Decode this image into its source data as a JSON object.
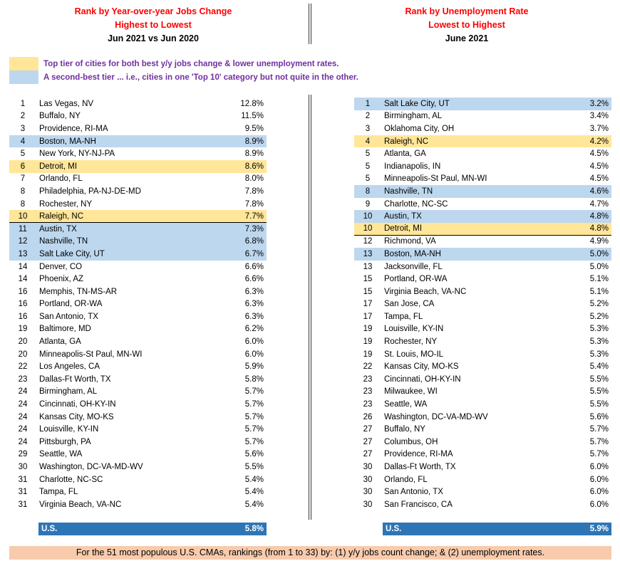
{
  "colors": {
    "title_red": "#ff0000",
    "legend_text": "#7030a0",
    "top_tier": "#ffe699",
    "second_tier": "#bdd7ee",
    "us_bar": "#2e75b6",
    "footer_bg": "#f8cbad"
  },
  "left": {
    "title1": "Rank by Year-over-year Jobs Change",
    "title2": "Highest to Lowest",
    "subtitle": "Jun 2021 vs Jun 2020",
    "rows": [
      {
        "rank": "1",
        "city": "Las Vegas, NV",
        "value": "12.8%",
        "tier": ""
      },
      {
        "rank": "2",
        "city": "Buffalo, NY",
        "value": "11.5%",
        "tier": ""
      },
      {
        "rank": "3",
        "city": "Providence, RI-MA",
        "value": "9.5%",
        "tier": ""
      },
      {
        "rank": "4",
        "city": "Boston, MA-NH",
        "value": "8.9%",
        "tier": "second"
      },
      {
        "rank": "5",
        "city": "New York, NY-NJ-PA",
        "value": "8.9%",
        "tier": ""
      },
      {
        "rank": "6",
        "city": "Detroit, MI",
        "value": "8.6%",
        "tier": "top"
      },
      {
        "rank": "7",
        "city": "Orlando, FL",
        "value": "8.0%",
        "tier": ""
      },
      {
        "rank": "8",
        "city": "Philadelphia, PA-NJ-DE-MD",
        "value": "7.8%",
        "tier": ""
      },
      {
        "rank": "8",
        "city": "Rochester, NY",
        "value": "7.8%",
        "tier": ""
      },
      {
        "rank": "10",
        "city": "Raleigh, NC",
        "value": "7.7%",
        "tier": "top",
        "separator": true
      },
      {
        "rank": "11",
        "city": "Austin, TX",
        "value": "7.3%",
        "tier": "second"
      },
      {
        "rank": "12",
        "city": "Nashville, TN",
        "value": "6.8%",
        "tier": "second"
      },
      {
        "rank": "13",
        "city": "Salt Lake City, UT",
        "value": "6.7%",
        "tier": "second"
      },
      {
        "rank": "14",
        "city": "Denver, CO",
        "value": "6.6%",
        "tier": ""
      },
      {
        "rank": "14",
        "city": "Phoenix, AZ",
        "value": "6.6%",
        "tier": ""
      },
      {
        "rank": "16",
        "city": "Memphis, TN-MS-AR",
        "value": "6.3%",
        "tier": ""
      },
      {
        "rank": "16",
        "city": "Portland, OR-WA",
        "value": "6.3%",
        "tier": ""
      },
      {
        "rank": "16",
        "city": "San Antonio, TX",
        "value": "6.3%",
        "tier": ""
      },
      {
        "rank": "19",
        "city": "Baltimore, MD",
        "value": "6.2%",
        "tier": ""
      },
      {
        "rank": "20",
        "city": "Atlanta, GA",
        "value": "6.0%",
        "tier": ""
      },
      {
        "rank": "20",
        "city": "Minneapolis-St Paul, MN-WI",
        "value": "6.0%",
        "tier": ""
      },
      {
        "rank": "22",
        "city": "Los Angeles, CA",
        "value": "5.9%",
        "tier": ""
      },
      {
        "rank": "23",
        "city": "Dallas-Ft Worth, TX",
        "value": "5.8%",
        "tier": ""
      },
      {
        "rank": "24",
        "city": "Birmingham, AL",
        "value": "5.7%",
        "tier": ""
      },
      {
        "rank": "24",
        "city": "Cincinnati, OH-KY-IN",
        "value": "5.7%",
        "tier": ""
      },
      {
        "rank": "24",
        "city": "Kansas City, MO-KS",
        "value": "5.7%",
        "tier": ""
      },
      {
        "rank": "24",
        "city": "Louisville, KY-IN",
        "value": "5.7%",
        "tier": ""
      },
      {
        "rank": "24",
        "city": "Pittsburgh, PA",
        "value": "5.7%",
        "tier": ""
      },
      {
        "rank": "29",
        "city": "Seattle, WA",
        "value": "5.6%",
        "tier": ""
      },
      {
        "rank": "30",
        "city": "Washington, DC-VA-MD-WV",
        "value": "5.5%",
        "tier": ""
      },
      {
        "rank": "31",
        "city": "Charlotte, NC-SC",
        "value": "5.4%",
        "tier": ""
      },
      {
        "rank": "31",
        "city": "Tampa, FL",
        "value": "5.4%",
        "tier": ""
      },
      {
        "rank": "31",
        "city": "Virginia Beach, VA-NC",
        "value": "5.4%",
        "tier": ""
      }
    ],
    "us": {
      "label": "U.S.",
      "value": "5.8%"
    }
  },
  "right": {
    "title1": "Rank by Unemployment Rate",
    "title2": "Lowest to Highest",
    "subtitle": "June 2021",
    "rows": [
      {
        "rank": "1",
        "city": "Salt Lake City, UT",
        "value": "3.2%",
        "tier": "second"
      },
      {
        "rank": "2",
        "city": "Birmingham, AL",
        "value": "3.4%",
        "tier": ""
      },
      {
        "rank": "3",
        "city": "Oklahoma City, OH",
        "value": "3.7%",
        "tier": ""
      },
      {
        "rank": "4",
        "city": "Raleigh, NC",
        "value": "4.2%",
        "tier": "top"
      },
      {
        "rank": "5",
        "city": "Atlanta, GA",
        "value": "4.5%",
        "tier": ""
      },
      {
        "rank": "5",
        "city": "Indianapolis, IN",
        "value": "4.5%",
        "tier": ""
      },
      {
        "rank": "5",
        "city": "Minneapolis-St Paul, MN-WI",
        "value": "4.5%",
        "tier": ""
      },
      {
        "rank": "8",
        "city": "Nashville, TN",
        "value": "4.6%",
        "tier": "second"
      },
      {
        "rank": "9",
        "city": "Charlotte, NC-SC",
        "value": "4.7%",
        "tier": ""
      },
      {
        "rank": "10",
        "city": "Austin, TX",
        "value": "4.8%",
        "tier": "second"
      },
      {
        "rank": "10",
        "city": "Detroit, MI",
        "value": "4.8%",
        "tier": "top",
        "separator": true
      },
      {
        "rank": "12",
        "city": "Richmond, VA",
        "value": "4.9%",
        "tier": ""
      },
      {
        "rank": "13",
        "city": "Boston, MA-NH",
        "value": "5.0%",
        "tier": "second"
      },
      {
        "rank": "13",
        "city": "Jacksonville, FL",
        "value": "5.0%",
        "tier": ""
      },
      {
        "rank": "15",
        "city": "Portland, OR-WA",
        "value": "5.1%",
        "tier": ""
      },
      {
        "rank": "15",
        "city": "Virginia Beach, VA-NC",
        "value": "5.1%",
        "tier": ""
      },
      {
        "rank": "17",
        "city": "San Jose, CA",
        "value": "5.2%",
        "tier": ""
      },
      {
        "rank": "17",
        "city": "Tampa, FL",
        "value": "5.2%",
        "tier": ""
      },
      {
        "rank": "19",
        "city": "Louisville, KY-IN",
        "value": "5.3%",
        "tier": ""
      },
      {
        "rank": "19",
        "city": "Rochester, NY",
        "value": "5.3%",
        "tier": ""
      },
      {
        "rank": "19",
        "city": "St. Louis, MO-IL",
        "value": "5.3%",
        "tier": ""
      },
      {
        "rank": "22",
        "city": "Kansas City, MO-KS",
        "value": "5.4%",
        "tier": ""
      },
      {
        "rank": "23",
        "city": "Cincinnati, OH-KY-IN",
        "value": "5.5%",
        "tier": ""
      },
      {
        "rank": "23",
        "city": "Milwaukee, WI",
        "value": "5.5%",
        "tier": ""
      },
      {
        "rank": "23",
        "city": "Seattle, WA",
        "value": "5.5%",
        "tier": ""
      },
      {
        "rank": "26",
        "city": "Washington, DC-VA-MD-WV",
        "value": "5.6%",
        "tier": ""
      },
      {
        "rank": "27",
        "city": "Buffalo, NY",
        "value": "5.7%",
        "tier": ""
      },
      {
        "rank": "27",
        "city": "Columbus, OH",
        "value": "5.7%",
        "tier": ""
      },
      {
        "rank": "27",
        "city": "Providence, RI-MA",
        "value": "5.7%",
        "tier": ""
      },
      {
        "rank": "30",
        "city": "Dallas-Ft Worth, TX",
        "value": "6.0%",
        "tier": ""
      },
      {
        "rank": "30",
        "city": "Orlando, FL",
        "value": "6.0%",
        "tier": ""
      },
      {
        "rank": "30",
        "city": "San Antonio, TX",
        "value": "6.0%",
        "tier": ""
      },
      {
        "rank": "30",
        "city": "San Francisco, CA",
        "value": "6.0%",
        "tier": ""
      }
    ],
    "us": {
      "label": "U.S.",
      "value": "5.9%"
    }
  },
  "legend": {
    "top_tier": "Top tier of cities for both best y/y jobs change & lower unemployment rates.",
    "second_tier": "A second-best tier ... i.e., cities in one 'Top 10' category but not quite in the other."
  },
  "footer": "For the 51 most populous U.S. CMAs, rankings (from 1 to 33) by: (1) y/y jobs count change; & (2) unemployment rates."
}
